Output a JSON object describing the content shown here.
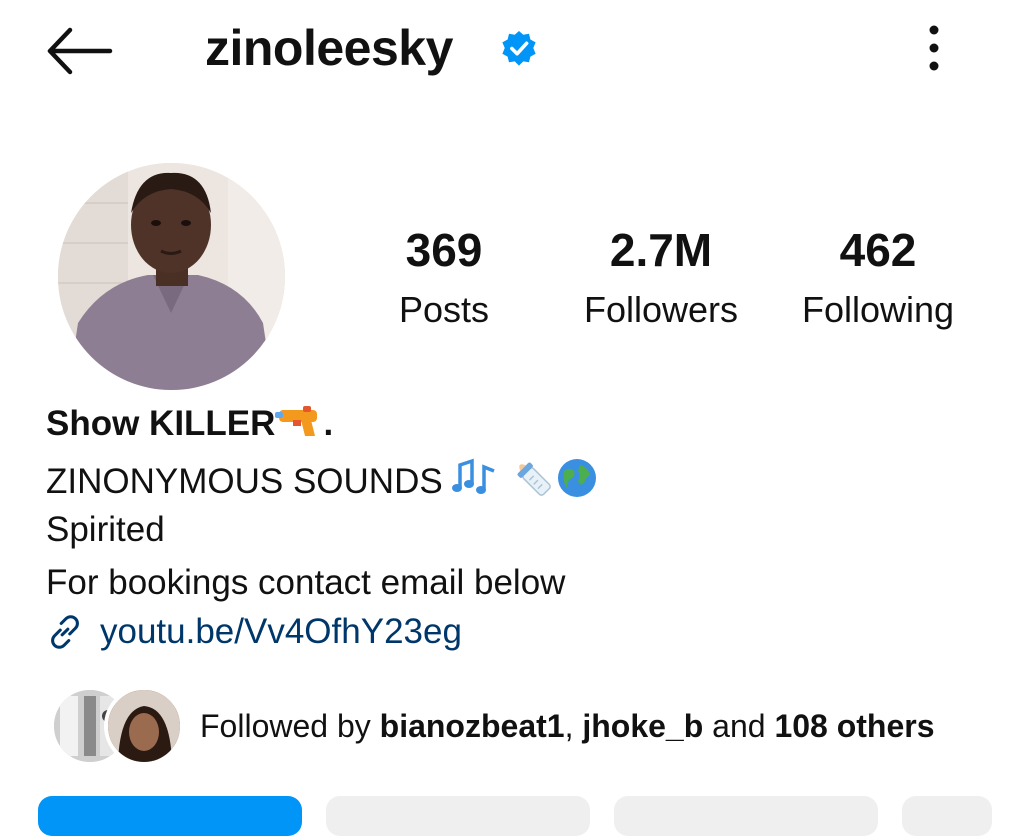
{
  "header": {
    "username": "zinoleesky",
    "verified_icon": "verified-badge-icon",
    "back_icon": "arrow-left-icon",
    "more_icon": "three-dots-vertical-icon"
  },
  "stats": [
    {
      "value": "369",
      "label": "Posts"
    },
    {
      "value": "2.7M",
      "label": "Followers"
    },
    {
      "value": "462",
      "label": "Following"
    }
  ],
  "bio": {
    "name": "Show KILLER",
    "name_suffix": ".",
    "line1": "ZINONYMOUS SOUNDS ",
    "line2": "Spirited",
    "line3": "For bookings contact email below",
    "link": "youtu.be/Vv4OfhY23eg",
    "link_icon": "link-icon"
  },
  "followed_by": {
    "prefix": "Followed by ",
    "user1": "bianozbeat1",
    "sep": ", ",
    "user2": "jhoke_b",
    "and": " and ",
    "others": "108 others"
  },
  "colors": {
    "accent": "#0095f6",
    "verified": "#0095f6",
    "link": "#00376b",
    "secondary_button": "#efefef"
  }
}
